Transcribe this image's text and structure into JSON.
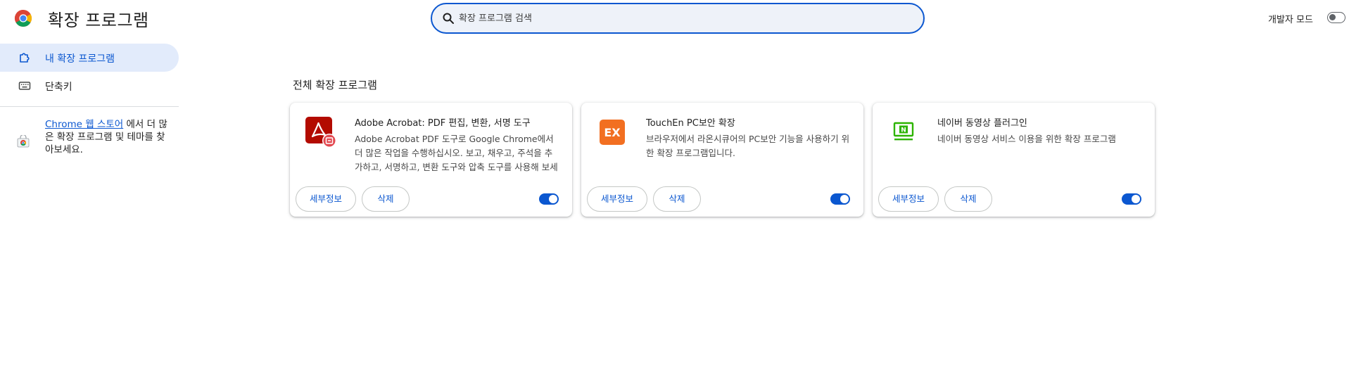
{
  "header": {
    "title": "확장 프로그램",
    "search_placeholder": "확장 프로그램 검색",
    "dev_mode_label": "개발자 모드",
    "dev_mode_enabled": false
  },
  "sidebar": {
    "items": [
      {
        "label": "내 확장 프로그램",
        "icon": "puzzle-icon",
        "active": true
      },
      {
        "label": "단축키",
        "icon": "keyboard-icon",
        "active": false
      }
    ],
    "store_promo": {
      "link_text": "Chrome 웹 스토어",
      "text": " 에서 더 많은 확장 프로그램 및 테마를 찾아보세요."
    }
  },
  "main": {
    "section_title": "전체 확장 프로그램",
    "extensions": [
      {
        "name": "Adobe Acrobat: PDF 편집, 변환, 서명 도구",
        "description": "Adobe Acrobat PDF 도구로 Google Chrome에서 더 많은 작업을 수행하십시오. 보고, 채우고, 주석을 추가하고, 서명하고, 변환 도구와 압축 도구를 사용해 보세요.",
        "icon": "adobe-acrobat-icon",
        "details_label": "세부정보",
        "remove_label": "삭제",
        "enabled": true
      },
      {
        "name": "TouchEn PC보안 확장",
        "description": "브라우저에서 라온시큐어의 PC보안 기능을 사용하기 위한 확장 프로그램입니다.",
        "icon": "touchen-ex-icon",
        "icon_text": "EX",
        "details_label": "세부정보",
        "remove_label": "삭제",
        "enabled": true
      },
      {
        "name": "네이버 동영상 플러그인",
        "description": "네이버 동영상 서비스 이용을 위한 확장 프로그램",
        "icon": "naver-video-icon",
        "icon_text": "N",
        "details_label": "세부정보",
        "remove_label": "삭제",
        "enabled": true
      }
    ]
  },
  "colors": {
    "accent": "#0b57d0",
    "adobe_red": "#b30b00",
    "touchen_orange": "#f26f21",
    "naver_green": "#2db400"
  }
}
